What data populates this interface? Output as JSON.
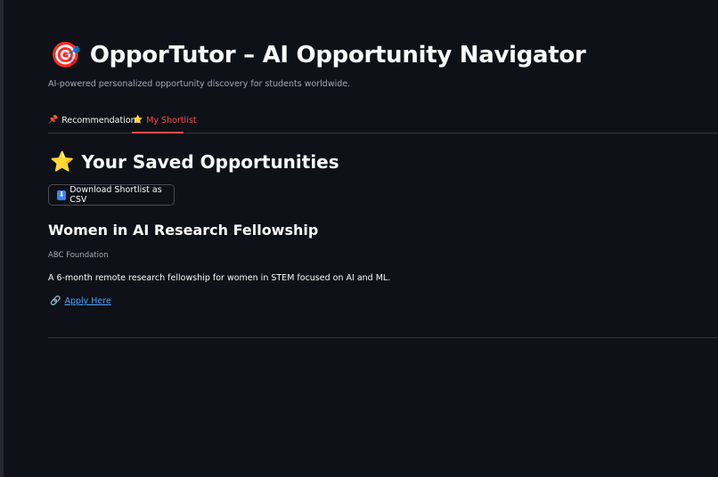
{
  "header": {
    "title_icon": "🎯",
    "title_icon_name": "target-icon",
    "title": "OpporTutor – AI Opportunity Navigator",
    "subtitle": "AI-powered personalized opportunity discovery for students worldwide."
  },
  "tabs": [
    {
      "icon": "📌",
      "icon_name": "pushpin-icon",
      "label": "Recommendations",
      "active": false
    },
    {
      "icon": "⭐",
      "icon_name": "star-icon",
      "label": "My Shortlist",
      "active": true
    }
  ],
  "shortlist": {
    "heading_icon": "⭐",
    "heading": "Your Saved Opportunities",
    "download_icon": "⬇",
    "download_label": "Download Shortlist as CSV",
    "items": [
      {
        "title": "Women in AI Research Fellowship",
        "organization": "ABC Foundation",
        "description": "A 6-month remote research fellowship for women in STEM focused on AI and ML.",
        "link_icon": "🔗",
        "link_label": "Apply Here"
      }
    ]
  },
  "colors": {
    "background": "#0e1117",
    "accent": "#ff4b4b",
    "link": "#4aa3ff",
    "text": "#fafafa",
    "muted_text": "#a3a8b8"
  }
}
